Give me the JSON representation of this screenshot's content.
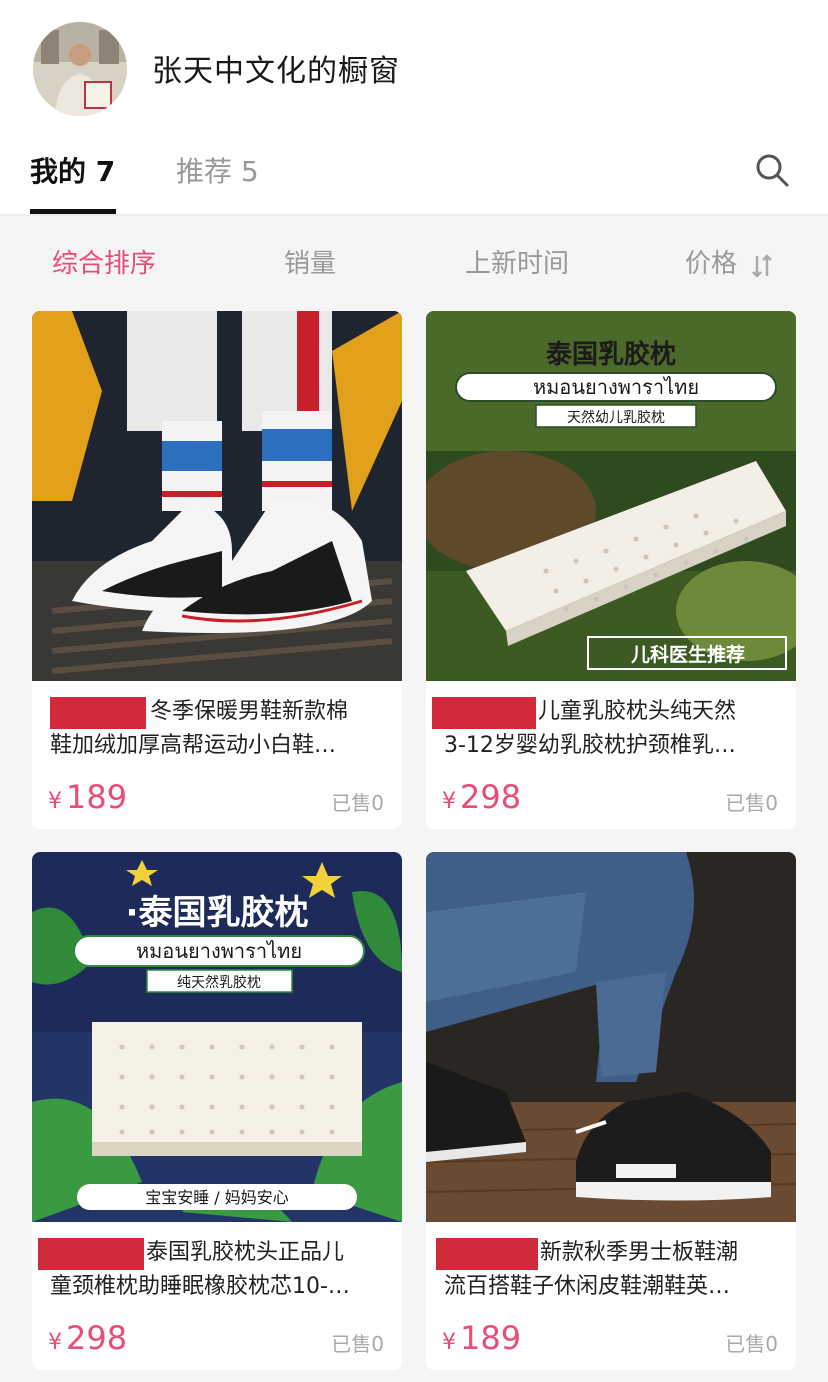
{
  "shop": {
    "title": "张天中文化的橱窗"
  },
  "tabs": [
    {
      "label": "我的 7",
      "active": true
    },
    {
      "label": "推荐 5",
      "active": false
    }
  ],
  "sort": [
    {
      "label": "综合排序",
      "active": true
    },
    {
      "label": "销量",
      "active": false
    },
    {
      "label": "上新时间",
      "active": false
    },
    {
      "label": "价格",
      "active": false
    }
  ],
  "colors": {
    "accent": "#e84d74",
    "muted": "#999999",
    "redact": "#d22a3a"
  },
  "products": [
    {
      "title_line1": "冬季保暖男鞋新款棉",
      "title_line2": "鞋加绒加厚高帮运动小白鞋…",
      "currency": "¥",
      "price": "189",
      "sold": "已售0"
    },
    {
      "title_line1": "儿童乳胶枕头纯天然",
      "title_line2": "3-12岁婴幼乳胶枕护颈椎乳…",
      "currency": "¥",
      "price": "298",
      "sold": "已售0",
      "image_text": {
        "headline": "泰国乳胶枕",
        "thai": "หมอนยางพาราไทย",
        "tag": "天然幼儿乳胶枕",
        "badge": "儿科医生推荐"
      }
    },
    {
      "title_line1": "泰国乳胶枕头正品儿",
      "title_line2": "童颈椎枕助睡眠橡胶枕芯10-…",
      "currency": "¥",
      "price": "298",
      "sold": "已售0",
      "image_text": {
        "headline": "·泰国乳胶枕",
        "thai": "หมอนยางพาราไทย",
        "tag": "纯天然乳胶枕",
        "badge": "宝宝安睡 / 妈妈安心"
      }
    },
    {
      "title_line1": "新款秋季男士板鞋潮",
      "title_line2": "流百搭鞋子休闲皮鞋潮鞋英…",
      "currency": "¥",
      "price": "189",
      "sold": "已售0"
    }
  ]
}
